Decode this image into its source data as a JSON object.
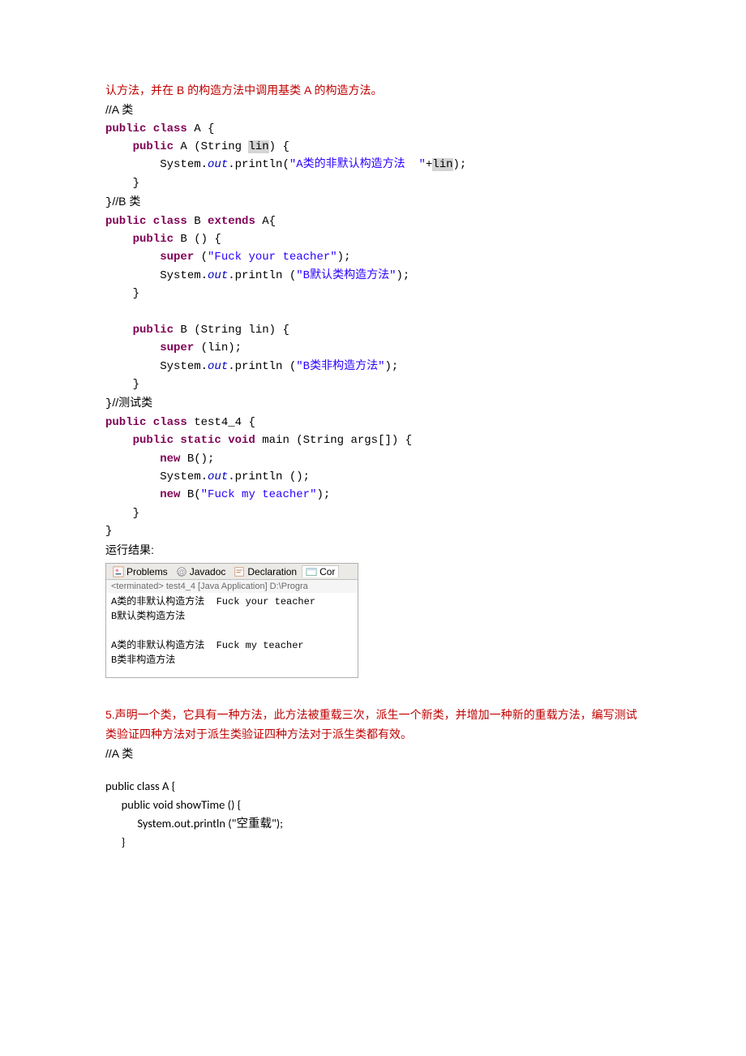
{
  "intro_red": "认方法，并在 B 的构造方法中调用基类 A 的构造方法。",
  "comment_a": "//A 类",
  "code": {
    "a1": "public class",
    "a2": " A {",
    "a3": "    public",
    "a4": " A (String ",
    "a4_hl": "lin",
    "a5": ") {",
    "a6": "        System.",
    "a6_out": "out",
    "a7": ".println(",
    "a7_str": "\"A类的非默认构造方法  \"",
    "a8": "+",
    "a8_hl": "lin",
    "a9": ");",
    "a10": "    }",
    "a11": "}",
    "b_comment": "//B 类",
    "b1": "public class",
    "b2": " B ",
    "b3": "extends",
    "b4": " A{",
    "b5": "    public",
    "b6": " B () {",
    "b7": "        super",
    "b8": " (",
    "b8_str": "\"Fuck your teacher\"",
    "b9": ");",
    "b10": "        System.",
    "b10_out": "out",
    "b11": ".println (",
    "b11_str": "\"B默认类构造方法\"",
    "b12": ");",
    "b13": "    }",
    "b14": "",
    "b15": "    public",
    "b16": " B (String lin) {",
    "b17": "        super",
    "b18": " (lin);",
    "b19": "        System.",
    "b19_out": "out",
    "b20": ".println (",
    "b20_str": "\"B类非构造方法\"",
    "b21": ");",
    "b22": "    }",
    "b23": "}",
    "t_comment": "//测试类",
    "t1": "public class",
    "t2": " test4_4 {",
    "t3": "    public static void",
    "t4": " main (String args[]) {",
    "t5": "        new",
    "t6": " B();",
    "t7": "        System.",
    "t7_out": "out",
    "t8": ".println ();",
    "t9": "        new",
    "t10": " B(",
    "t10_str": "\"Fuck my teacher\"",
    "t11": ");",
    "t12": "    }",
    "t13": "}"
  },
  "run_label": "运行结果:",
  "console": {
    "tabs": [
      "Problems",
      "Javadoc",
      "Declaration",
      "Cor"
    ],
    "terminated": "<terminated> test4_4 [Java Application] D:\\Progra",
    "output": "A类的非默认构造方法  Fuck your teacher\nB默认类构造方法\n\nA类的非默认构造方法  Fuck my teacher\nB类非构造方法\n"
  },
  "q5_red": "5.声明一个类，它具有一种方法，此方法被重载三次，派生一个新类，并增加一种新的重载方法，编写测试类验证四种方法对于派生类验证四种方法对于派生类都有效。",
  "q5_comment": "//A 类",
  "q5_code": "public class A {\n      public void showTime () {\n            System.out.println (\"空重载\");\n      }"
}
